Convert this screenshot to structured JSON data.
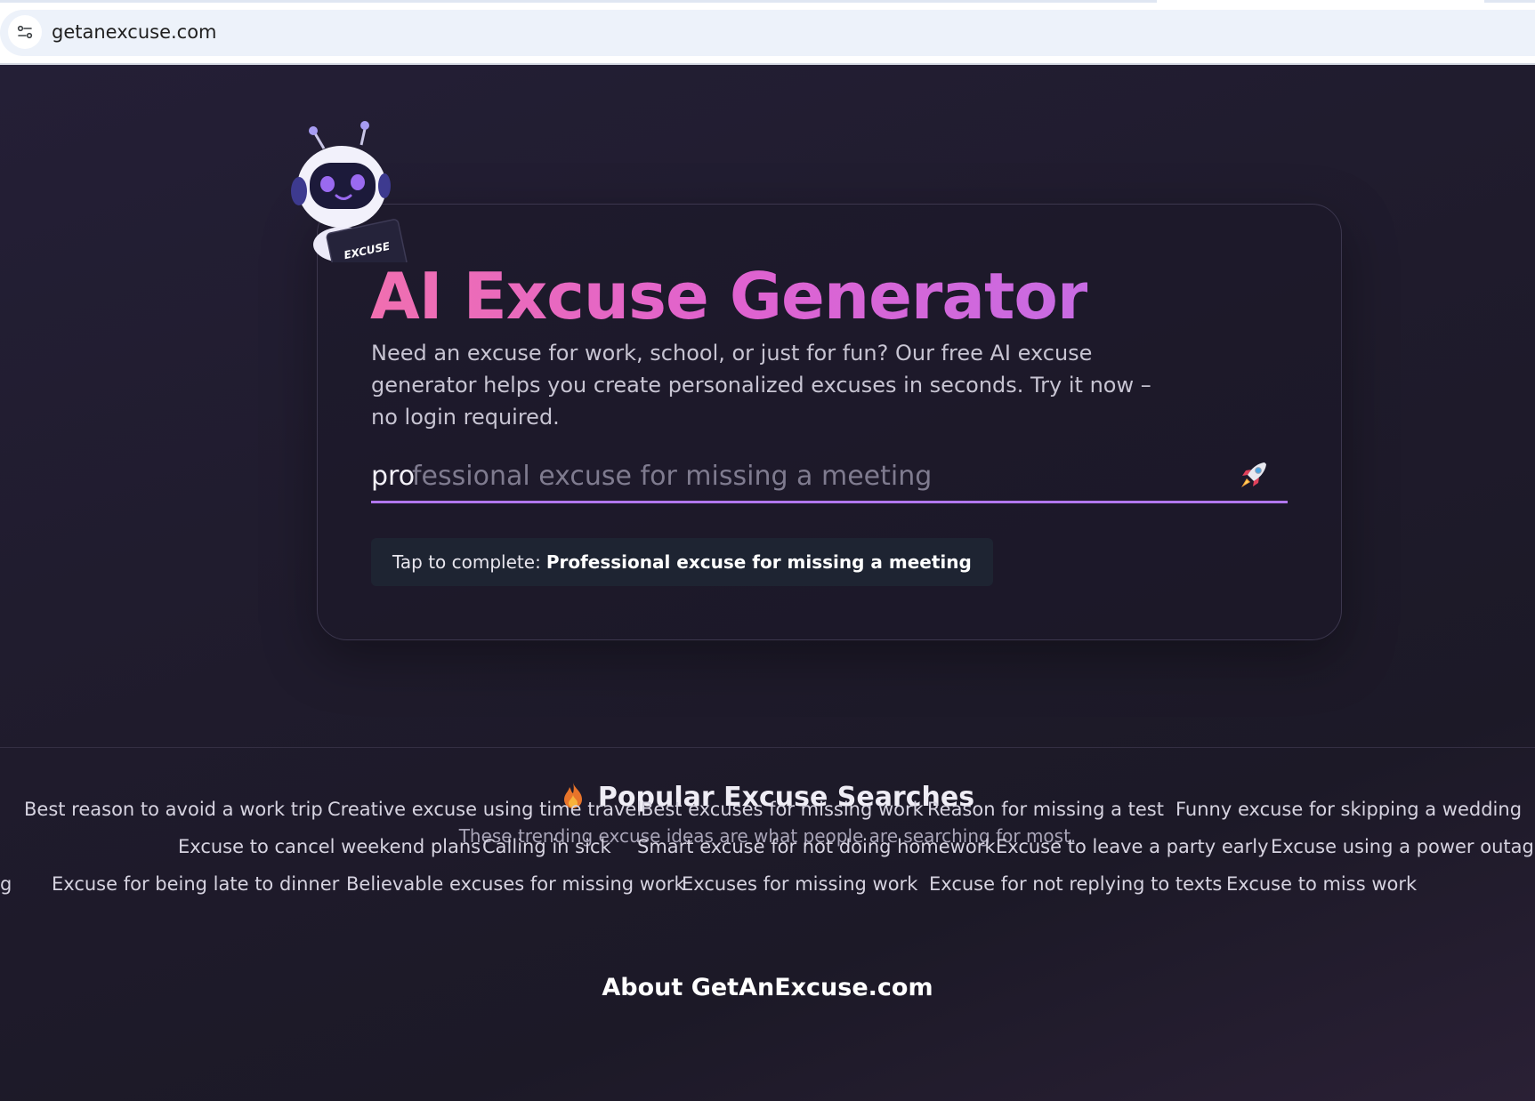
{
  "browser": {
    "url": "getanexcuse.com"
  },
  "hero": {
    "robot_badge": "EXCUSE",
    "title": "AI Excuse Generator",
    "description": "Need an excuse for work, school, or just for fun? Our free AI excuse generator helps you create personalized excuses in seconds. Try it now – no login required.",
    "search": {
      "typed_value": "pro",
      "autocomplete_ghost": "fessional excuse for missing a meeting"
    },
    "complete": {
      "prefix": "Tap to complete:",
      "suggestion": "Professional excuse for missing a meeting"
    }
  },
  "popular": {
    "heading": "Popular Excuse Searches",
    "subtitle": "These trending excuse ideas are what people are searching for most.",
    "rows": [
      [
        "Best reason to avoid a work trip",
        "Creative excuse using time travel",
        "Best excuses for missing work",
        "Reason for missing a test",
        "Funny excuse for skipping a wedding"
      ],
      [
        "Excuse to cancel weekend plans",
        "Calling in sick",
        "Smart excuse for not doing homework",
        "Excuse to leave a party early",
        "Excuse using a power outage"
      ],
      [
        "g",
        "Excuse for being late to dinner",
        "Believable excuses for missing work",
        "Excuses for missing work",
        "Excuse for not replying to texts",
        "Excuse to miss work"
      ]
    ]
  },
  "about": {
    "heading": "About GetAnExcuse.com"
  },
  "colors": {
    "accent": "#b177ee",
    "title_gradient_start": "#f06fb0",
    "title_gradient_end": "#c86be3",
    "background": "#201c30"
  }
}
